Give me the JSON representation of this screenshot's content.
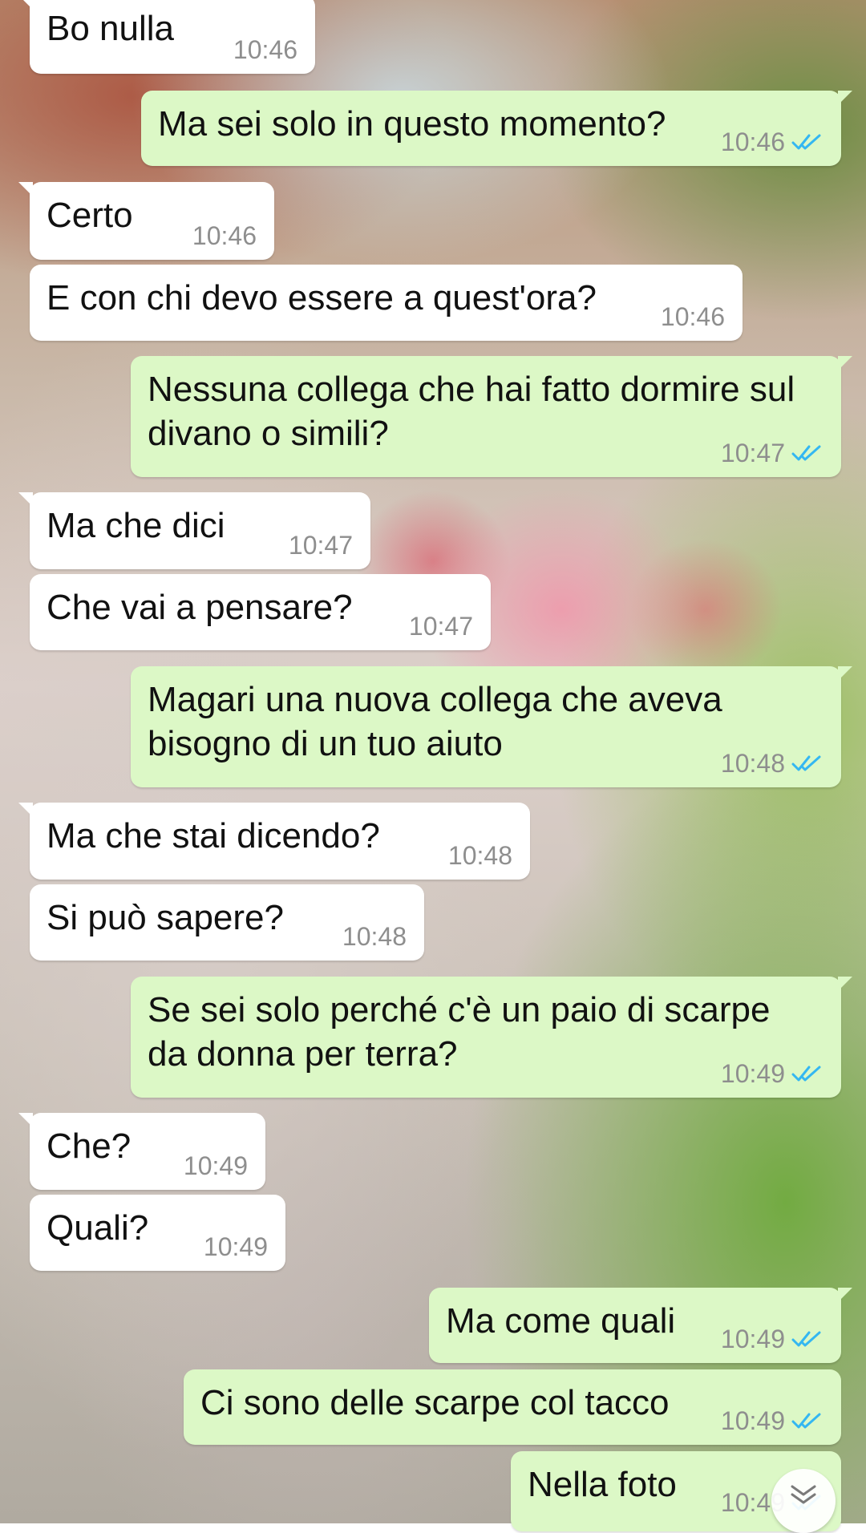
{
  "colors": {
    "incoming_bubble": "#ffffff",
    "outgoing_bubble": "#dcf8c6",
    "timestamp": "#8e8e8e",
    "read_ticks": "#34b7f1"
  },
  "messages": [
    {
      "direction": "in",
      "text": "Bo nulla",
      "time": "10:46"
    },
    {
      "direction": "out",
      "text": "Ma sei solo in questo momento?",
      "time": "10:46",
      "status": "read"
    },
    {
      "direction": "in",
      "text": "Certo",
      "time": "10:46"
    },
    {
      "direction": "in",
      "text": "E con chi devo essere a quest'ora?",
      "time": "10:46"
    },
    {
      "direction": "out",
      "text": "Nessuna collega che hai fatto dormire sul\ndivano o simili?",
      "time": "10:47",
      "status": "read"
    },
    {
      "direction": "in",
      "text": "Ma che dici",
      "time": "10:47"
    },
    {
      "direction": "in",
      "text": "Che vai a pensare?",
      "time": "10:47"
    },
    {
      "direction": "out",
      "text": "Magari una nuova collega che aveva\nbisogno di un tuo aiuto",
      "time": "10:48",
      "status": "read"
    },
    {
      "direction": "in",
      "text": "Ma che stai dicendo?",
      "time": "10:48"
    },
    {
      "direction": "in",
      "text": "Si può sapere?",
      "time": "10:48"
    },
    {
      "direction": "out",
      "text": "Se sei solo perché c'è un paio di scarpe\nda donna per terra?",
      "time": "10:49",
      "status": "read"
    },
    {
      "direction": "in",
      "text": "Che?",
      "time": "10:49"
    },
    {
      "direction": "in",
      "text": "Quali?",
      "time": "10:49"
    },
    {
      "direction": "out",
      "text": "Ma come quali",
      "time": "10:49",
      "status": "read"
    },
    {
      "direction": "out",
      "text": "Ci sono delle scarpe col tacco",
      "time": "10:49",
      "status": "read"
    },
    {
      "direction": "out",
      "text": "Nella foto",
      "time": "10:49",
      "status": "read"
    }
  ],
  "icons": {
    "read_status": "double-check-icon",
    "scroll_down": "chevron-double-down-icon"
  }
}
